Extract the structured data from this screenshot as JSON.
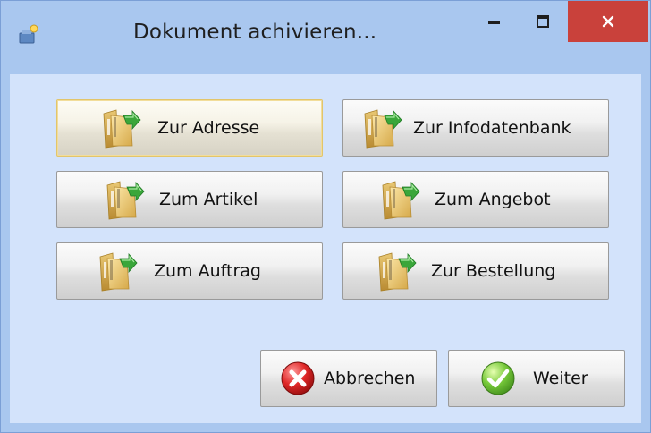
{
  "window": {
    "title": "Dokument achivieren...",
    "controls": {
      "minimize_icon": "minimize-icon",
      "maximize_icon": "maximize-icon",
      "close_icon": "close-icon"
    },
    "colors": {
      "titlebar": "#a9c7ef",
      "client": "#d3e3fb",
      "close": "#c9413b"
    }
  },
  "nav_buttons": [
    {
      "label": "Zur Adresse",
      "icon": "folder-arrow-icon"
    },
    {
      "label": "Zur Infodatenbank",
      "icon": "folder-arrow-icon"
    },
    {
      "label": "Zum Artikel",
      "icon": "folder-arrow-icon"
    },
    {
      "label": "Zum Angebot",
      "icon": "folder-arrow-icon"
    },
    {
      "label": "Zum Auftrag",
      "icon": "folder-arrow-icon"
    },
    {
      "label": "Zur Bestellung",
      "icon": "folder-arrow-icon"
    }
  ],
  "actions": {
    "cancel": {
      "label": "Abbrechen",
      "icon": "cancel-x-icon"
    },
    "next": {
      "label": "Weiter",
      "icon": "checkmark-icon"
    }
  }
}
